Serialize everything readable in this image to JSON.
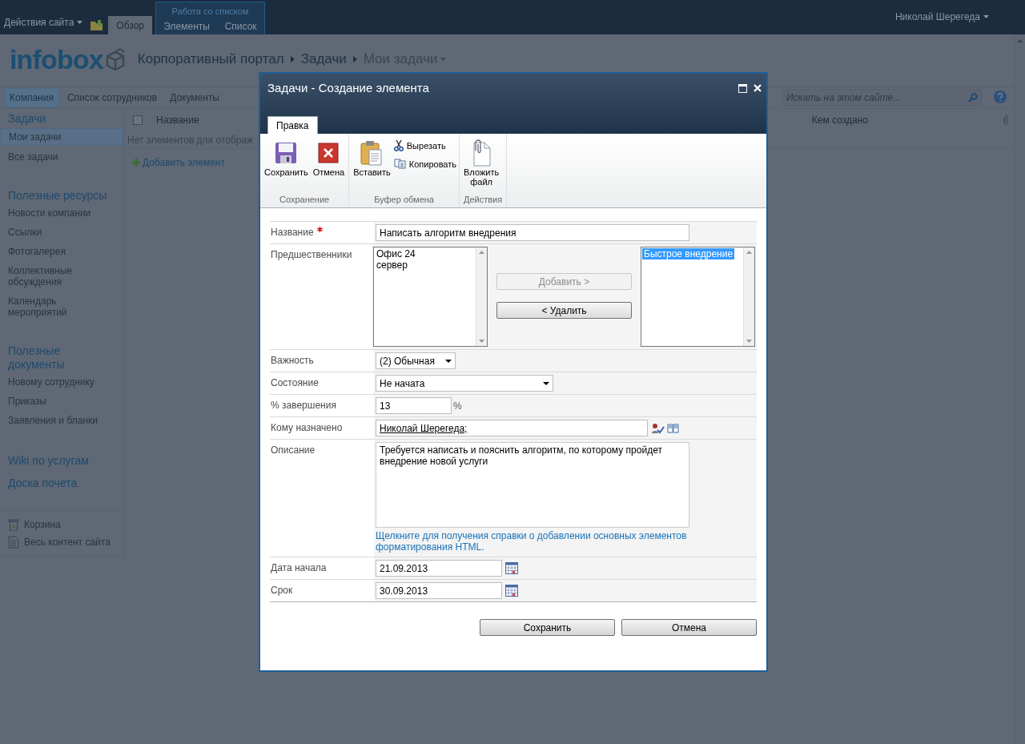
{
  "top_bar": {
    "site_actions": "Действия сайта",
    "tabs": [
      {
        "label": "Обзор",
        "selected": true
      }
    ],
    "context_group": {
      "title": "Работа со списком",
      "tabs": [
        {
          "label": "Элементы",
          "selected": false
        },
        {
          "label": "Список",
          "selected": false
        }
      ]
    },
    "user": "Николай Шерегеда"
  },
  "header": {
    "logo": "infobox",
    "breadcrumb": [
      "Корпоративный портал",
      "Задачи",
      "Мои задачи"
    ]
  },
  "top_nav": {
    "items": [
      {
        "label": "Компания",
        "selected": true
      },
      {
        "label": "Список сотрудников",
        "selected": false
      },
      {
        "label": "Документы",
        "selected": false
      }
    ],
    "search": {
      "placeholder": "Искать на этом сайте..."
    }
  },
  "sidebar": {
    "sections": [
      {
        "heading": "Задачи",
        "items": [
          {
            "label": "Мои задачи",
            "selected": true
          },
          {
            "label": "Все задачи",
            "selected": false
          }
        ]
      },
      {
        "heading": "Полезные ресурсы",
        "items": [
          {
            "label": "Новости компании",
            "selected": false
          },
          {
            "label": "Ссылки",
            "selected": false
          },
          {
            "label": "Фотогалерея",
            "selected": false
          },
          {
            "label": "Коллективные обсуждения",
            "selected": false
          },
          {
            "label": "Календарь мероприятий",
            "selected": false
          }
        ]
      },
      {
        "heading": "Полезные документы",
        "items": [
          {
            "label": "Новому сотруднику",
            "selected": false
          },
          {
            "label": "Приказы",
            "selected": false
          },
          {
            "label": "Заявления и бланки",
            "selected": false
          }
        ]
      },
      {
        "heading": "Wiki по услугам"
      },
      {
        "heading": "Доска почета"
      }
    ],
    "footer": [
      {
        "label": "Корзина",
        "kind": "recycle"
      },
      {
        "label": "Весь контент сайта",
        "kind": "content"
      }
    ]
  },
  "list": {
    "select_all_checked": false,
    "columns": [
      "Название",
      "Кем создано"
    ],
    "empty_message": "Нет элементов для отображ",
    "add_link": "Добавить элемент"
  },
  "dialog": {
    "title": "Задачи - Создание элемента",
    "ribbon": {
      "tabs": [
        {
          "label": "Правка",
          "selected": true
        }
      ],
      "groups": [
        {
          "label": "Сохранение",
          "buttons": [
            {
              "label": "Сохранить",
              "kind": "save"
            },
            {
              "label": "Отмена",
              "kind": "cancel"
            }
          ]
        },
        {
          "label": "Буфер обмена",
          "buttons": [
            {
              "label": "Вставить",
              "kind": "paste"
            },
            {
              "label": "Вырезать",
              "kind": "cut"
            },
            {
              "label": "Копировать",
              "kind": "copy"
            }
          ]
        },
        {
          "label": "Действия",
          "buttons": [
            {
              "label": "Вложить файл",
              "kind": "attach"
            }
          ]
        }
      ]
    },
    "fields": [
      {
        "label": "Название",
        "kind": "text",
        "required": true,
        "value": "Написать алгоритм внедрения"
      },
      {
        "label": "Предшественники",
        "kind": "picker",
        "required": false,
        "available": [
          {
            "label": "Офис 24",
            "selected": false
          },
          {
            "label": "сервер",
            "selected": false
          }
        ],
        "chosen": [
          {
            "label": "Быстрое внедрение",
            "selected": true
          }
        ],
        "add_button": {
          "label": "Добавить >",
          "disabled": true
        },
        "remove_button": {
          "label": "< Удалить",
          "disabled": false
        }
      },
      {
        "label": "Важность",
        "kind": "shortselect",
        "required": false,
        "value": "(2) Обычная"
      },
      {
        "label": "Состояние",
        "kind": "select",
        "required": false,
        "value": "Не начата"
      },
      {
        "label": "% завершения",
        "kind": "percent",
        "required": false,
        "value": "13",
        "suffix": "%"
      },
      {
        "label": "Кому назначено",
        "kind": "people",
        "required": false,
        "value": "Николай Шерегеда;"
      },
      {
        "label": "Описание",
        "kind": "textarea",
        "required": false,
        "value": "Требуется написать и пояснить алгоритм, по которому пройдет внедрение новой услуги",
        "help_link": "Щелкните для получения справки о добавлении основных элементов форматирования HTML."
      },
      {
        "label": "Дата начала",
        "kind": "date",
        "required": false,
        "value": "21.09.2013"
      },
      {
        "label": "Срок",
        "kind": "date",
        "required": false,
        "value": "30.09.2013"
      }
    ],
    "buttons": [
      "Сохранить",
      "Отмена"
    ]
  }
}
